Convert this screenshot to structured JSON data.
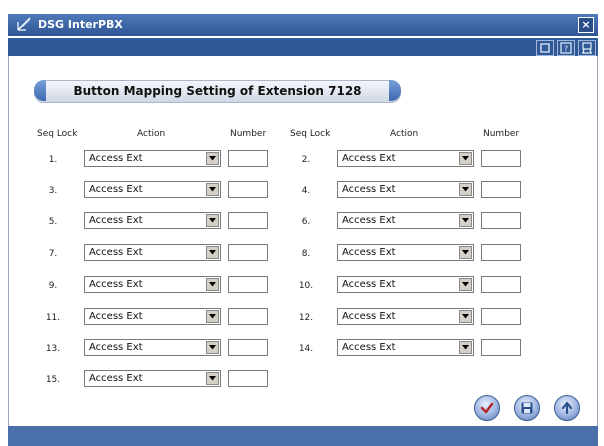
{
  "window": {
    "title": "DSG InterPBX",
    "close_glyph": "×"
  },
  "page": {
    "heading": "Button Mapping Setting of Extension 7128",
    "col_seq": "Seq Lock",
    "col_action": "Action",
    "col_number": "Number"
  },
  "rows": [
    {
      "seq": "1.",
      "action": "Access Ext",
      "number": ""
    },
    {
      "seq": "2.",
      "action": "Access Ext",
      "number": ""
    },
    {
      "seq": "3.",
      "action": "Access Ext",
      "number": ""
    },
    {
      "seq": "4.",
      "action": "Access Ext",
      "number": ""
    },
    {
      "seq": "5.",
      "action": "Access Ext",
      "number": ""
    },
    {
      "seq": "6.",
      "action": "Access Ext",
      "number": ""
    },
    {
      "seq": "7.",
      "action": "Access Ext",
      "number": ""
    },
    {
      "seq": "8.",
      "action": "Access Ext",
      "number": ""
    },
    {
      "seq": "9.",
      "action": "Access Ext",
      "number": ""
    },
    {
      "seq": "10.",
      "action": "Access Ext",
      "number": ""
    },
    {
      "seq": "11.",
      "action": "Access Ext",
      "number": ""
    },
    {
      "seq": "12.",
      "action": "Access Ext",
      "number": ""
    },
    {
      "seq": "13.",
      "action": "Access Ext",
      "number": ""
    },
    {
      "seq": "14.",
      "action": "Access Ext",
      "number": ""
    },
    {
      "seq": "15.",
      "action": "Access Ext",
      "number": ""
    }
  ],
  "icons": {
    "toolbar": [
      "window-icon",
      "help-icon",
      "user-icon"
    ],
    "actions": [
      "confirm-icon",
      "save-icon",
      "upload-icon"
    ]
  },
  "colors": {
    "titlebar": "#2f5595",
    "accent": "#3b68b0"
  }
}
